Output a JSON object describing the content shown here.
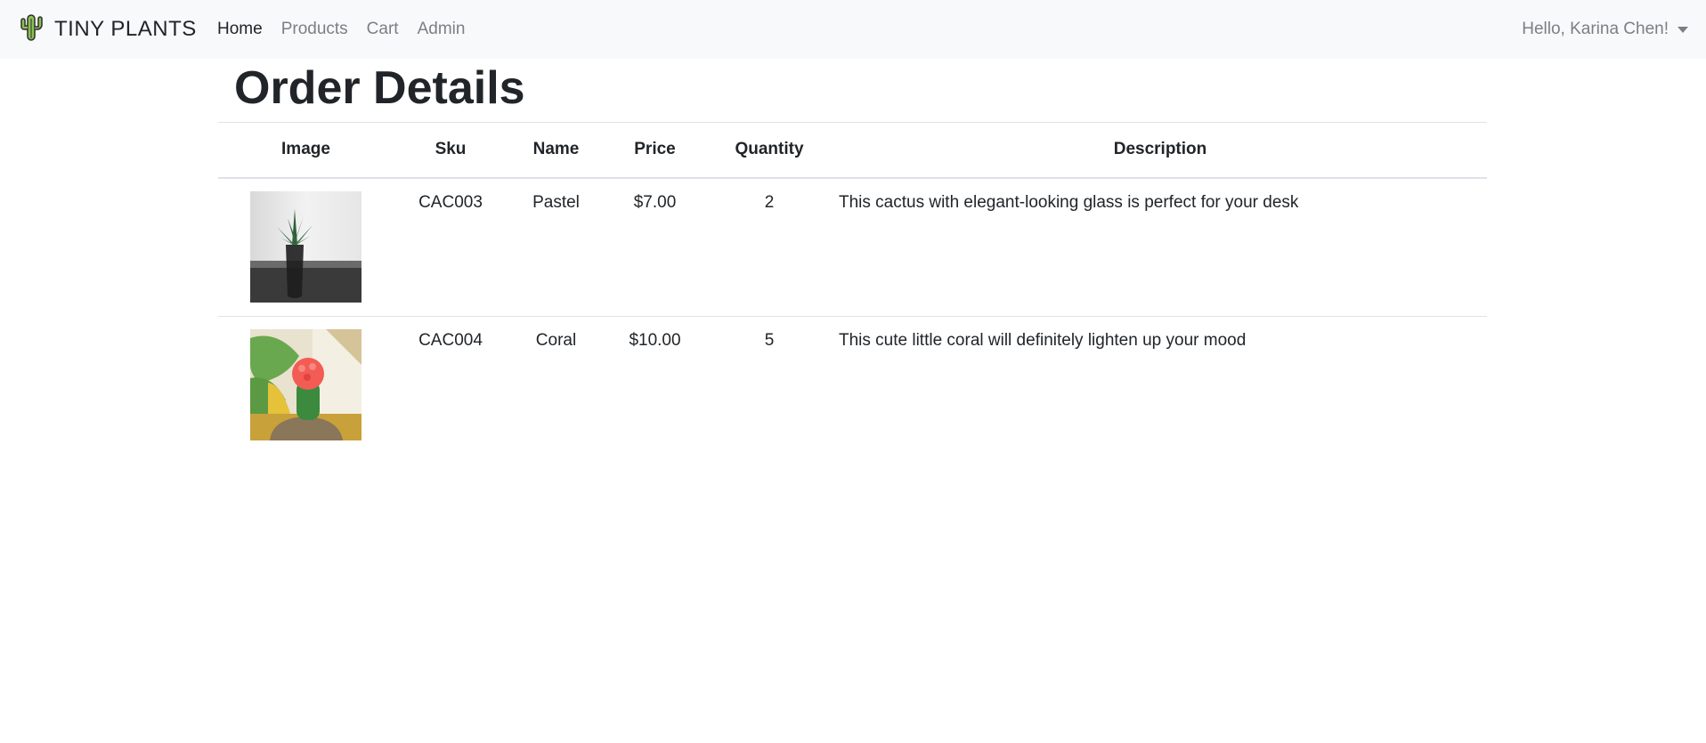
{
  "navbar": {
    "brand": "TINY PLANTS",
    "brand_icon": "cactus-icon",
    "links": [
      "Home",
      "Products",
      "Cart",
      "Admin"
    ],
    "active_link": "Home",
    "user_greeting": "Hello, Karina Chen!"
  },
  "page": {
    "title": "Order Details"
  },
  "table": {
    "headers": [
      "Image",
      "Sku",
      "Name",
      "Price",
      "Quantity",
      "Description"
    ],
    "rows": [
      {
        "sku": "CAC003",
        "name": "Pastel",
        "price": "$7.00",
        "quantity": "2",
        "description": "This cactus with elegant-looking glass is perfect for your desk"
      },
      {
        "sku": "CAC004",
        "name": "Coral",
        "price": "$10.00",
        "quantity": "5",
        "description": "This cute little coral will definitely lighten up your mood"
      }
    ]
  },
  "colors": {
    "navbar_bg": "#f8f9fa",
    "nav_link": "#7b7f84",
    "text": "#212529",
    "border": "#dee2e6"
  }
}
